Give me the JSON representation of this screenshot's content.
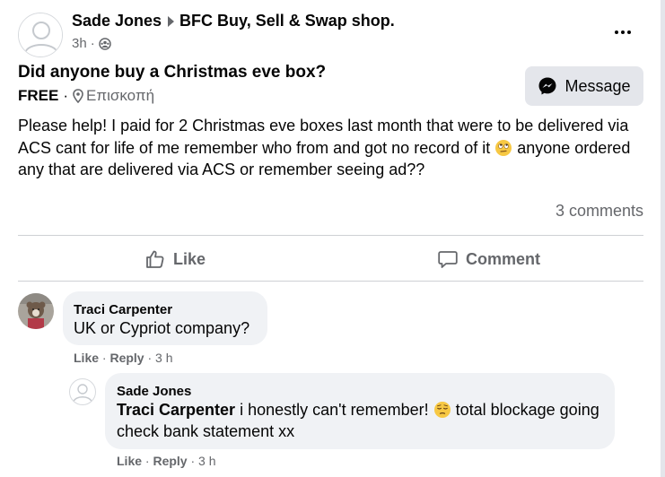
{
  "post": {
    "author": "Sade Jones",
    "group": "BFC Buy, Sell & Swap shop.",
    "time": "3h",
    "separator": "·",
    "privacy_icon": "group-audience-icon",
    "more_icon": "more-options-icon"
  },
  "listing": {
    "title": "Did anyone buy a Christmas eve box?",
    "price": "FREE",
    "dot": "·",
    "location": "Επισκοπή",
    "message_button": "Message",
    "body_part1": "Please help! I paid for 2 Christmas eve boxes last month that were to be delivered via ACS cant for life of me remember who from and got no record of it ",
    "body_emoji": "rolling-eyes-emoji",
    "body_part2": " anyone ordered any that are delivered via ACS or remember seeing ad??"
  },
  "stats": {
    "comments": "3 comments"
  },
  "actions": {
    "like": "Like",
    "comment": "Comment"
  },
  "comments": [
    {
      "author": "Traci Carpenter",
      "text": "UK or Cypriot company?",
      "like": "Like",
      "reply": "Reply",
      "time": "3 h",
      "dot": "·"
    },
    {
      "author": "Sade Jones",
      "mention": "Traci Carpenter",
      "text_part1": " i honestly can't remember! ",
      "emoji": "pensive-emoji",
      "text_part2": " total blockage going check bank statement xx",
      "like": "Like",
      "reply": "Reply",
      "time": "3 h",
      "dot": "·"
    }
  ],
  "colors": {
    "text_primary": "#050505",
    "text_secondary": "#65676b",
    "bubble_bg": "#f0f2f5",
    "button_bg": "#e4e6eb",
    "divider": "#ced0d4"
  }
}
